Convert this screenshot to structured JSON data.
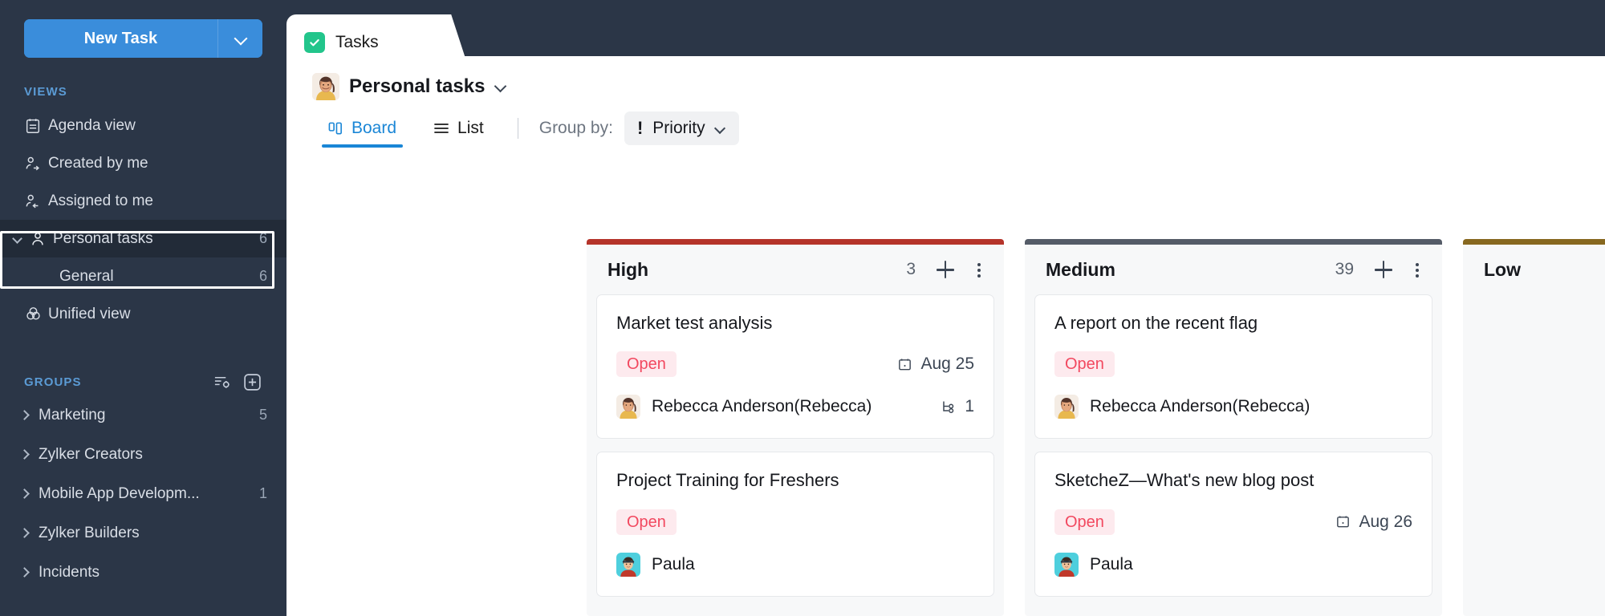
{
  "sidebar": {
    "new_task": {
      "label": "New Task",
      "caret_icon": "chevron-down-icon"
    },
    "views_header": "VIEWS",
    "views": [
      {
        "label": "Agenda view",
        "icon": "agenda-icon",
        "count": ""
      },
      {
        "label": "Created by me",
        "icon": "user-out-icon",
        "count": ""
      },
      {
        "label": "Assigned to me",
        "icon": "user-in-icon",
        "count": ""
      },
      {
        "label": "Personal tasks",
        "icon": "user-icon",
        "count": "6",
        "active": true,
        "expanded": true
      },
      {
        "label": "Unified view",
        "icon": "venn-icon",
        "count": ""
      }
    ],
    "personal_sub": [
      {
        "label": "General",
        "count": "6"
      }
    ],
    "groups_header": "GROUPS",
    "groups_actions": [
      {
        "icon": "filter-settings-icon"
      },
      {
        "icon": "add-box-icon"
      }
    ],
    "groups": [
      {
        "label": "Marketing",
        "count": "5"
      },
      {
        "label": "Zylker Creators",
        "count": ""
      },
      {
        "label": "Mobile App Developm...",
        "count": "1"
      },
      {
        "label": "Zylker Builders",
        "count": ""
      },
      {
        "label": "Incidents",
        "count": ""
      }
    ]
  },
  "tab": {
    "label": "Tasks",
    "icon": "check-square-icon"
  },
  "project": {
    "name": "Personal tasks",
    "caret_icon": "chevron-down-icon",
    "avatar": "rebecca-avatar"
  },
  "toolbar": {
    "board_label": "Board",
    "board_icon": "board-columns-icon",
    "list_label": "List",
    "list_icon": "list-lines-icon",
    "group_by_label": "Group by:",
    "group_by_value": "Priority",
    "group_by_icon": "exclamation-icon",
    "group_by_caret": "chevron-down-icon"
  },
  "colors": {
    "high_bar": "#b5342a",
    "medium_bar": "#555c68",
    "low_bar": "#87681f",
    "accent": "#1a86d6",
    "sidebar_bg": "#2b3647",
    "status_open_text": "#f2485f",
    "status_open_bg": "#fdeaee",
    "tab_check_bg": "#22c58b"
  },
  "board": {
    "columns": [
      {
        "title": "High",
        "count": "3",
        "bar_color": "#b5342a",
        "show_count": true,
        "show_menu": true,
        "cards": [
          {
            "title": "Market test analysis",
            "status": "Open",
            "due": "Aug 25",
            "due_icon": "calendar-icon",
            "assignee": "Rebecca Anderson(Rebecca)",
            "avatar": "rebecca-avatar",
            "subtask_count": "1",
            "subtask_icon": "subtask-icon"
          },
          {
            "title": "Project Training for Freshers",
            "status": "Open",
            "due": "",
            "due_icon": "",
            "assignee": "Paula",
            "avatar": "paula-avatar",
            "subtask_count": "",
            "subtask_icon": ""
          }
        ]
      },
      {
        "title": "Medium",
        "count": "39",
        "bar_color": "#555c68",
        "show_count": true,
        "show_menu": true,
        "cards": [
          {
            "title": "A report on the recent flag",
            "status": "Open",
            "due": "",
            "due_icon": "",
            "assignee": "Rebecca Anderson(Rebecca)",
            "avatar": "rebecca-avatar",
            "subtask_count": "",
            "subtask_icon": ""
          },
          {
            "title": "SketcheZ—What's new blog post",
            "status": "Open",
            "due": "Aug 26",
            "due_icon": "calendar-icon",
            "assignee": "Paula",
            "avatar": "paula-avatar",
            "subtask_count": "",
            "subtask_icon": ""
          }
        ]
      },
      {
        "title": "Low",
        "count": "",
        "bar_color": "#87681f",
        "show_count": false,
        "show_menu": false,
        "cards": []
      }
    ]
  }
}
